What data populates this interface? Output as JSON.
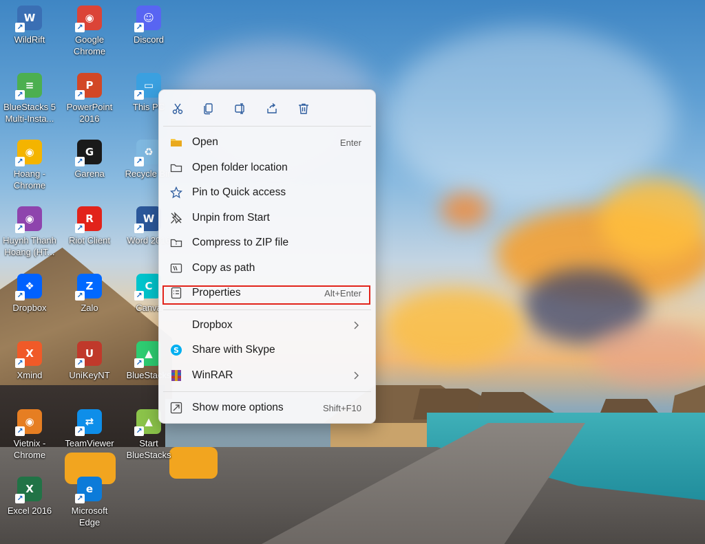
{
  "desktop": {
    "icons": [
      {
        "label": "WildRift",
        "icon": "wildrift-icon",
        "color": "#3a6fb4"
      },
      {
        "label": "Google Chrome",
        "icon": "chrome-icon",
        "color": "#db4437"
      },
      {
        "label": "Discord",
        "icon": "discord-icon",
        "color": "#5865f2"
      },
      {
        "label": "BlueStacks 5 Multi-Insta...",
        "icon": "bluestacks-multi-icon",
        "color": "#4caf50"
      },
      {
        "label": "PowerPoint 2016",
        "icon": "powerpoint-icon",
        "color": "#d24726"
      },
      {
        "label": "This PC",
        "icon": "this-pc-icon",
        "color": "#3aa0e0"
      },
      {
        "label": "Hoang - Chrome",
        "icon": "chrome-profile-icon",
        "color": "#f4b400"
      },
      {
        "label": "Garena",
        "icon": "garena-icon",
        "color": "#1a1a1a"
      },
      {
        "label": "Recycle Bin",
        "icon": "recycle-bin-icon",
        "color": "#7fb8e0"
      },
      {
        "label": "Huynh Thanh Hoang (HT...",
        "icon": "chrome-profile-icon",
        "color": "#8e44ad"
      },
      {
        "label": "Riot Client",
        "icon": "riot-client-icon",
        "color": "#e2231a"
      },
      {
        "label": "Word 2016",
        "icon": "word-icon",
        "color": "#2b579a"
      },
      {
        "label": "Dropbox",
        "icon": "dropbox-icon",
        "color": "#0061fe"
      },
      {
        "label": "Zalo",
        "icon": "zalo-icon",
        "color": "#0068ff"
      },
      {
        "label": "Canva",
        "icon": "canva-icon",
        "color": "#00c4cc"
      },
      {
        "label": "Xmind",
        "icon": "xmind-icon",
        "color": "#f05a28"
      },
      {
        "label": "UniKeyNT",
        "icon": "unikey-icon",
        "color": "#c0392b"
      },
      {
        "label": "BlueStacks",
        "icon": "bluestacks-icon",
        "color": "#2ecc71"
      },
      {
        "label": "Vietnix - Chrome",
        "icon": "chrome-profile-icon",
        "color": "#e67e22"
      },
      {
        "label": "TeamViewer",
        "icon": "teamviewer-icon",
        "color": "#0e8ee9"
      },
      {
        "label": "Start BlueStacks",
        "icon": "bluestacks-icon",
        "color": "#8bc34a"
      },
      {
        "label": "Excel 2016",
        "icon": "excel-icon",
        "color": "#217346"
      },
      {
        "label": "Microsoft Edge",
        "icon": "edge-icon",
        "color": "#0c7bd9"
      }
    ]
  },
  "context_menu": {
    "actions": [
      "cut-icon",
      "copy-icon",
      "rename-icon",
      "share-icon",
      "delete-icon"
    ],
    "items": [
      {
        "label": "Open",
        "shortcut": "Enter",
        "icon": "folder-open-icon"
      },
      {
        "label": "Open folder location",
        "shortcut": "",
        "icon": "folder-icon"
      },
      {
        "label": "Pin to Quick access",
        "shortcut": "",
        "icon": "star-icon"
      },
      {
        "label": "Unpin from Start",
        "shortcut": "",
        "icon": "unpin-icon"
      },
      {
        "label": "Compress to ZIP file",
        "shortcut": "",
        "icon": "zip-icon"
      },
      {
        "label": "Copy as path",
        "shortcut": "",
        "icon": "copy-path-icon"
      },
      {
        "label": "Properties",
        "shortcut": "Alt+Enter",
        "icon": "properties-icon"
      },
      {
        "label": "Dropbox",
        "shortcut": "",
        "icon": ""
      },
      {
        "label": "Share with Skype",
        "shortcut": "",
        "icon": "skype-icon"
      },
      {
        "label": "WinRAR",
        "shortcut": "",
        "icon": "winrar-icon"
      },
      {
        "label": "Show more options",
        "shortcut": "Shift+F10",
        "icon": "more-options-icon"
      }
    ],
    "highlight_color": "#e2231a",
    "accent_color": "#0067c0"
  }
}
